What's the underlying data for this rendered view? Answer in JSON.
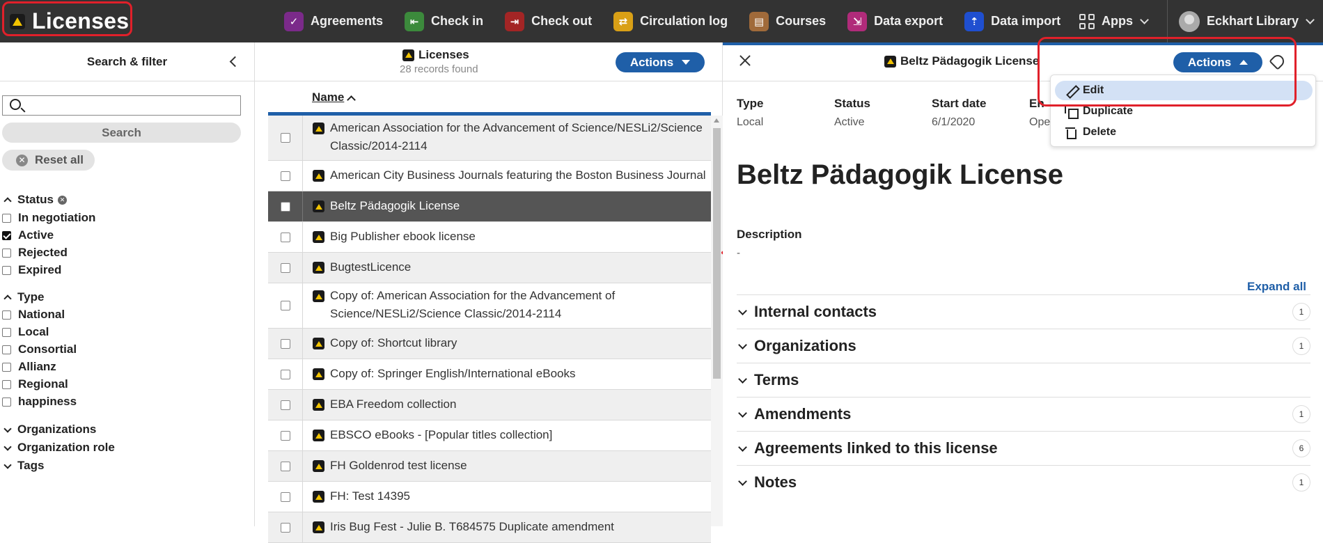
{
  "app": {
    "title": "Licenses"
  },
  "nav": {
    "items": [
      {
        "label": "Agreements",
        "icon": "agreements-icon",
        "color": "#7b2a8a",
        "glyph": "✓"
      },
      {
        "label": "Check in",
        "icon": "checkin-icon",
        "color": "#3c8a3c",
        "glyph": "⇤"
      },
      {
        "label": "Check out",
        "icon": "checkout-icon",
        "color": "#a32525",
        "glyph": "⇥"
      },
      {
        "label": "Circulation log",
        "icon": "circulation-log-icon",
        "color": "#d9a016",
        "glyph": "⇄"
      },
      {
        "label": "Courses",
        "icon": "courses-icon",
        "color": "#a06a3a",
        "glyph": "▤"
      },
      {
        "label": "Data export",
        "icon": "data-export-icon",
        "color": "#b02b7a",
        "glyph": "⇲"
      },
      {
        "label": "Data import",
        "icon": "data-import-icon",
        "color": "#1f4fd0",
        "glyph": "⇡"
      }
    ],
    "apps_label": "Apps",
    "user_label": "Eckhart Library"
  },
  "filter": {
    "title": "Search & filter",
    "search_button": "Search",
    "reset_button": "Reset all",
    "status": {
      "label": "Status",
      "options": [
        {
          "label": "In negotiation",
          "checked": false
        },
        {
          "label": "Active",
          "checked": true
        },
        {
          "label": "Rejected",
          "checked": false
        },
        {
          "label": "Expired",
          "checked": false
        }
      ]
    },
    "type": {
      "label": "Type",
      "options": [
        {
          "label": "National",
          "checked": false
        },
        {
          "label": "Local",
          "checked": false
        },
        {
          "label": "Consortial",
          "checked": false
        },
        {
          "label": "Allianz",
          "checked": false
        },
        {
          "label": "Regional",
          "checked": false
        },
        {
          "label": "happiness",
          "checked": false
        }
      ]
    },
    "collapsed_facets": [
      "Organizations",
      "Organization role",
      "Tags"
    ]
  },
  "results": {
    "title": "Licenses",
    "count": "28 records found",
    "actions_label": "Actions",
    "column_name": "Name",
    "rows": [
      {
        "name": "American Association for the Advancement of Science/NESLi2/Science Classic/2014-2114",
        "lines": 2,
        "selected": false
      },
      {
        "name": "American City Business Journals featuring the Boston Business Journal",
        "lines": 1,
        "selected": false
      },
      {
        "name": "Beltz Pädagogik License",
        "lines": 1,
        "selected": true
      },
      {
        "name": "Big Publisher ebook license",
        "lines": 1,
        "selected": false
      },
      {
        "name": "BugtestLicence",
        "lines": 1,
        "selected": false
      },
      {
        "name": "Copy of: American Association for the Advancement of Science/NESLi2/Science Classic/2014-2114",
        "lines": 2,
        "selected": false
      },
      {
        "name": "Copy of: Shortcut library",
        "lines": 1,
        "selected": false
      },
      {
        "name": "Copy of: Springer English/International eBooks",
        "lines": 1,
        "selected": false
      },
      {
        "name": "EBA Freedom collection",
        "lines": 1,
        "selected": false
      },
      {
        "name": "EBSCO eBooks - [Popular titles collection]",
        "lines": 1,
        "selected": false
      },
      {
        "name": "FH Goldenrod test license",
        "lines": 1,
        "selected": false
      },
      {
        "name": "FH: Test 14395",
        "lines": 1,
        "selected": false
      },
      {
        "name": "Iris Bug Fest - Julie B. T684575 Duplicate amendment",
        "lines": 1,
        "selected": false
      }
    ]
  },
  "detail": {
    "header_title": "Beltz Pädagogik License",
    "actions_label": "Actions",
    "fields": [
      {
        "key": "Type",
        "value": "Local"
      },
      {
        "key": "Status",
        "value": "Active"
      },
      {
        "key": "Start date",
        "value": "6/1/2020"
      },
      {
        "key": "En",
        "value": "Ope"
      }
    ],
    "title": "Beltz Pädagogik License",
    "description_label": "Description",
    "description_value": "-",
    "expand_all": "Expand all",
    "accordions": [
      {
        "label": "Internal contacts",
        "count": "1"
      },
      {
        "label": "Organizations",
        "count": "1"
      },
      {
        "label": "Terms",
        "count": ""
      },
      {
        "label": "Amendments",
        "count": "1"
      },
      {
        "label": "Agreements linked to this license",
        "count": "6"
      },
      {
        "label": "Notes",
        "count": "1"
      }
    ],
    "menu": [
      {
        "label": "Edit",
        "icon": "pencil-icon"
      },
      {
        "label": "Duplicate",
        "icon": "duplicate-icon"
      },
      {
        "label": "Delete",
        "icon": "trash-icon"
      }
    ]
  },
  "colors": {
    "accent": "#1f5fa8",
    "topbar": "#333333",
    "highlight": "#e0202a",
    "selected_row": "#555555"
  }
}
